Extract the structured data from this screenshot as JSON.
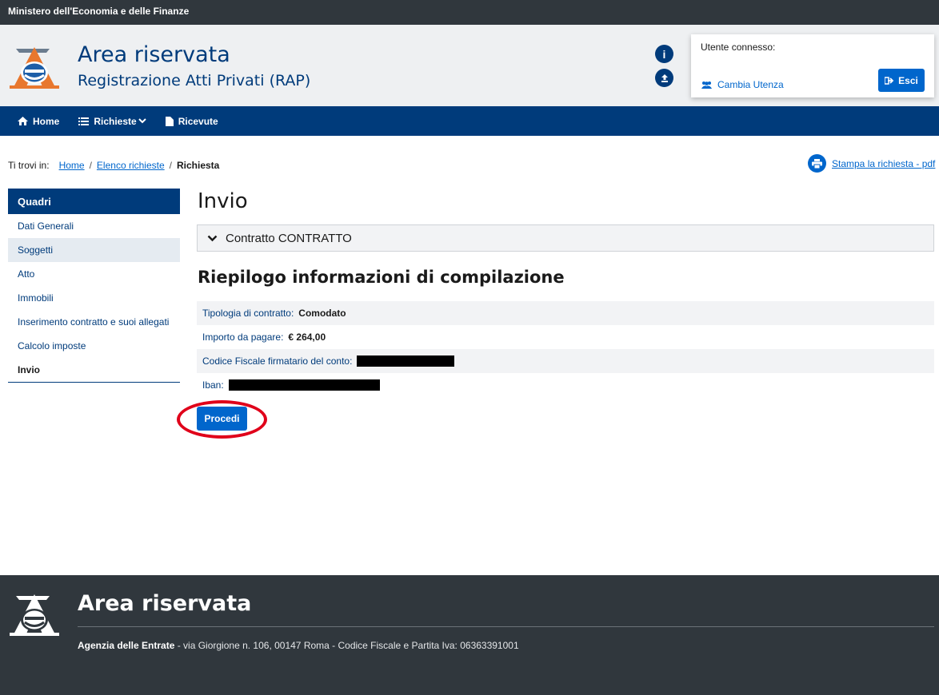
{
  "ministry": "Ministero dell'Economia e delle Finanze",
  "header": {
    "title": "Area riservata",
    "subtitle": "Registrazione Atti Privati (RAP)",
    "user_label": "Utente connesso:",
    "switch_user": "Cambia Utenza",
    "exit": "Esci"
  },
  "nav": {
    "home": "Home",
    "requests": "Richieste",
    "receipts": "Ricevute"
  },
  "breadcrumb": {
    "prefix": "Ti trovi in:",
    "items": [
      "Home",
      "Elenco richieste"
    ],
    "current": "Richiesta"
  },
  "print_link": "Stampa la richiesta - pdf",
  "sidebar": {
    "title": "Quadri",
    "items": [
      "Dati Generali",
      "Soggetti",
      "Atto",
      "Immobili",
      "Inserimento contratto e suoi allegati",
      "Calcolo imposte",
      "Invio"
    ]
  },
  "main": {
    "title": "Invio",
    "accordion": "Contratto CONTRATTO",
    "summary_title": "Riepilogo informazioni di compilazione",
    "rows": [
      {
        "label": "Tipologia di contratto:",
        "value": "Comodato"
      },
      {
        "label": "Importo da pagare:",
        "value": "€ 264,00"
      },
      {
        "label": "Codice Fiscale firmatario del conto:",
        "value": ""
      },
      {
        "label": "Iban:",
        "value": ""
      }
    ],
    "proceed": "Procedi"
  },
  "footer": {
    "title": "Area riservata",
    "agency": "Agenzia delle Entrate",
    "address": " - via Giorgione n. 106, 00147 Roma - Codice Fiscale e Partita Iva: 06363391001"
  },
  "colors": {
    "brand_blue": "#003b7b",
    "accent_blue": "#0066cc",
    "dark_bar": "#30373d",
    "highlight": "#e0001a"
  }
}
